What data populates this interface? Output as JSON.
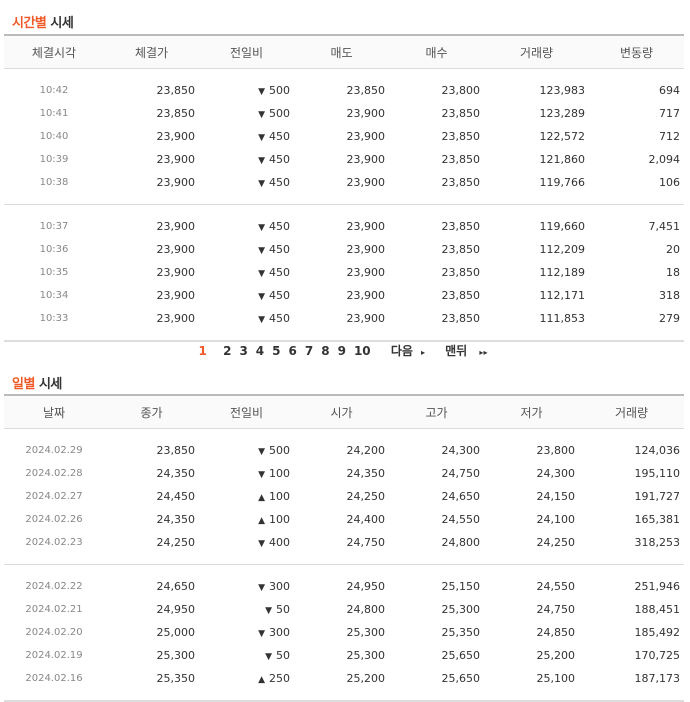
{
  "time_section": {
    "title_hl": "시간별",
    "title_rest": " 시세",
    "headers": [
      "체결시각",
      "체결가",
      "전일비",
      "매도",
      "매수",
      "거래량",
      "변동량"
    ],
    "groups": [
      [
        {
          "time": "10:42",
          "price": "23,850",
          "dir": "down",
          "chg": "500",
          "ask": "23,850",
          "bid": "23,800",
          "vol": "123,983",
          "delta": "694"
        },
        {
          "time": "10:41",
          "price": "23,850",
          "dir": "down",
          "chg": "500",
          "ask": "23,900",
          "bid": "23,850",
          "vol": "123,289",
          "delta": "717"
        },
        {
          "time": "10:40",
          "price": "23,900",
          "dir": "down",
          "chg": "450",
          "ask": "23,900",
          "bid": "23,850",
          "vol": "122,572",
          "delta": "712"
        },
        {
          "time": "10:39",
          "price": "23,900",
          "dir": "down",
          "chg": "450",
          "ask": "23,900",
          "bid": "23,850",
          "vol": "121,860",
          "delta": "2,094"
        },
        {
          "time": "10:38",
          "price": "23,900",
          "dir": "down",
          "chg": "450",
          "ask": "23,900",
          "bid": "23,850",
          "vol": "119,766",
          "delta": "106"
        }
      ],
      [
        {
          "time": "10:37",
          "price": "23,900",
          "dir": "down",
          "chg": "450",
          "ask": "23,900",
          "bid": "23,850",
          "vol": "119,660",
          "delta": "7,451"
        },
        {
          "time": "10:36",
          "price": "23,900",
          "dir": "down",
          "chg": "450",
          "ask": "23,900",
          "bid": "23,850",
          "vol": "112,209",
          "delta": "20"
        },
        {
          "time": "10:35",
          "price": "23,900",
          "dir": "down",
          "chg": "450",
          "ask": "23,900",
          "bid": "23,850",
          "vol": "112,189",
          "delta": "18"
        },
        {
          "time": "10:34",
          "price": "23,900",
          "dir": "down",
          "chg": "450",
          "ask": "23,900",
          "bid": "23,850",
          "vol": "112,171",
          "delta": "318"
        },
        {
          "time": "10:33",
          "price": "23,900",
          "dir": "down",
          "chg": "450",
          "ask": "23,900",
          "bid": "23,850",
          "vol": "111,853",
          "delta": "279"
        }
      ]
    ]
  },
  "pagination": {
    "current": "1",
    "pages": [
      "2",
      "3",
      "4",
      "5",
      "6",
      "7",
      "8",
      "9",
      "10"
    ],
    "next_label": "다음",
    "last_label": "맨뒤",
    "next_icon": "▸",
    "last_icon": "▸▸"
  },
  "daily_section": {
    "title_hl": "일별",
    "title_rest": " 시세",
    "headers": [
      "날짜",
      "종가",
      "전일비",
      "시가",
      "고가",
      "저가",
      "거래량"
    ],
    "groups": [
      [
        {
          "date": "2024.02.29",
          "close": "23,850",
          "dir": "down",
          "chg": "500",
          "open": "24,200",
          "high": "24,300",
          "low": "23,800",
          "vol": "124,036"
        },
        {
          "date": "2024.02.28",
          "close": "24,350",
          "dir": "down",
          "chg": "100",
          "open": "24,350",
          "high": "24,750",
          "low": "24,300",
          "vol": "195,110"
        },
        {
          "date": "2024.02.27",
          "close": "24,450",
          "dir": "up",
          "chg": "100",
          "open": "24,250",
          "high": "24,650",
          "low": "24,150",
          "vol": "191,727"
        },
        {
          "date": "2024.02.26",
          "close": "24,350",
          "dir": "up",
          "chg": "100",
          "open": "24,400",
          "high": "24,550",
          "low": "24,100",
          "vol": "165,381"
        },
        {
          "date": "2024.02.23",
          "close": "24,250",
          "dir": "down",
          "chg": "400",
          "open": "24,750",
          "high": "24,800",
          "low": "24,250",
          "vol": "318,253"
        }
      ],
      [
        {
          "date": "2024.02.22",
          "close": "24,650",
          "dir": "down",
          "chg": "300",
          "open": "24,950",
          "high": "25,150",
          "low": "24,550",
          "vol": "251,946"
        },
        {
          "date": "2024.02.21",
          "close": "24,950",
          "dir": "down",
          "chg": "50",
          "open": "24,800",
          "high": "25,300",
          "low": "24,750",
          "vol": "188,451"
        },
        {
          "date": "2024.02.20",
          "close": "25,000",
          "dir": "down",
          "chg": "300",
          "open": "25,300",
          "high": "25,350",
          "low": "24,850",
          "vol": "185,492"
        },
        {
          "date": "2024.02.19",
          "close": "25,300",
          "dir": "down",
          "chg": "50",
          "open": "25,300",
          "high": "25,650",
          "low": "25,200",
          "vol": "170,725"
        },
        {
          "date": "2024.02.16",
          "close": "25,350",
          "dir": "up",
          "chg": "250",
          "open": "25,200",
          "high": "25,650",
          "low": "25,100",
          "vol": "187,173"
        }
      ]
    ]
  },
  "colors": {
    "accent": "#f05a28",
    "down": "#1b5fcf",
    "up": "#d7261e"
  },
  "icons": {
    "down": "▼",
    "up": "▲"
  }
}
